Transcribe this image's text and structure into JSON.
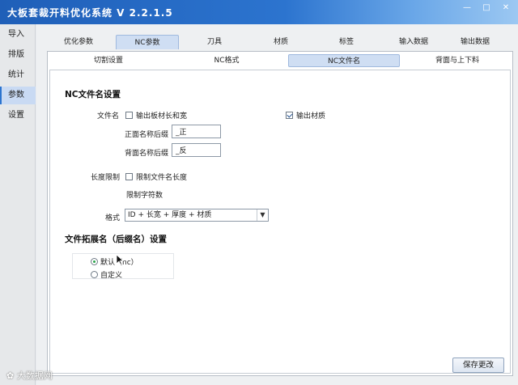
{
  "window": {
    "title": "大板套裁开料优化系统 V 2.2.1.5",
    "minimize": "—",
    "maximize": "□",
    "close": "✕"
  },
  "sidebar": {
    "items": [
      {
        "label": "导入",
        "active": false
      },
      {
        "label": "排版",
        "active": false
      },
      {
        "label": "统计",
        "active": false
      },
      {
        "label": "参数",
        "active": true
      },
      {
        "label": "设置",
        "active": false
      }
    ]
  },
  "tabs_main": [
    {
      "label": "优化参数",
      "active": false
    },
    {
      "label": "NC参数",
      "active": true
    },
    {
      "label": "刀具",
      "active": false
    },
    {
      "label": "材质",
      "active": false
    },
    {
      "label": "标签",
      "active": false
    },
    {
      "label": "输入数据",
      "active": false
    },
    {
      "label": "输出数据",
      "active": false
    }
  ],
  "tabs_sub": [
    {
      "label": "切割设置",
      "active": false
    },
    {
      "label": "NC格式",
      "active": false
    },
    {
      "label": "NC文件名",
      "active": true
    },
    {
      "label": "背面与上下料",
      "active": false
    }
  ],
  "nc_filename": {
    "section_title": "NC文件名设置",
    "filename_label": "文件名",
    "output_size_label": "输出板材长和宽",
    "output_size_checked": false,
    "output_material_label": "输出材质",
    "output_material_checked": true,
    "front_suffix_label": "正面名称后缀",
    "front_suffix_value": "_正",
    "back_suffix_label": "背面名称后缀",
    "back_suffix_value": "_反",
    "length_limit_label": "长度限制",
    "limit_length_label": "限制文件名长度",
    "limit_length_checked": false,
    "limit_chars_label": "限制字符数",
    "format_label": "格式",
    "format_value": "ID + 长宽 + 厚度 + 材质"
  },
  "extension": {
    "section_title": "文件拓展名（后缀名）设置",
    "default_label": "默认（nc）",
    "default_selected": true,
    "custom_label": "自定义",
    "custom_selected": false
  },
  "save_button": "保存更改",
  "watermark": "大数据网"
}
